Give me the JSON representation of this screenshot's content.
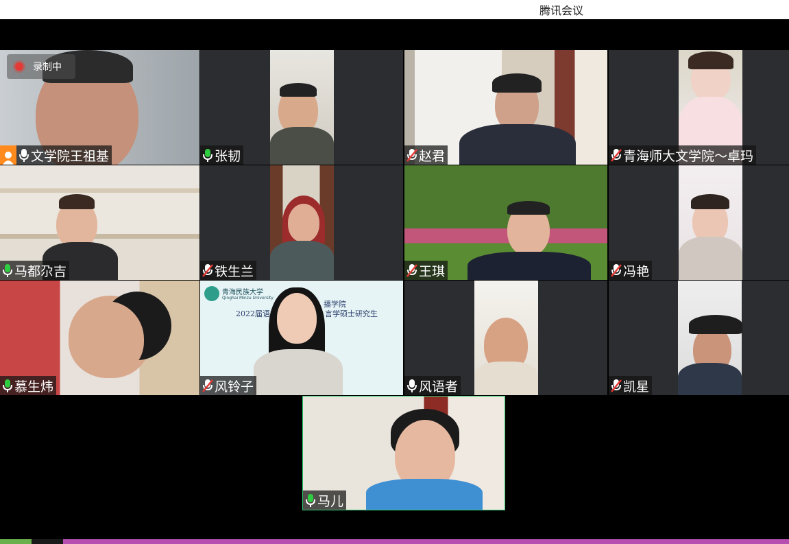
{
  "window": {
    "title": "腾讯会议"
  },
  "recording": {
    "label": "录制中"
  },
  "participants": [
    {
      "name": "文学院王祖基",
      "mic": "on",
      "host": true
    },
    {
      "name": "张韧",
      "mic": "on"
    },
    {
      "name": "赵君",
      "mic": "muted"
    },
    {
      "name": "青海师大文学院～卓玛",
      "mic": "muted"
    },
    {
      "name": "马都尕吉",
      "mic": "on"
    },
    {
      "name": "铁生兰",
      "mic": "muted"
    },
    {
      "name": "王琪",
      "mic": "muted"
    },
    {
      "name": "冯艳",
      "mic": "muted"
    },
    {
      "name": "慕生炜",
      "mic": "on"
    },
    {
      "name": "风铃子",
      "mic": "muted"
    },
    {
      "name": "风语者",
      "mic": "on"
    },
    {
      "name": "凯星",
      "mic": "muted"
    },
    {
      "name": "马儿",
      "mic": "on",
      "active_speaker": true
    }
  ],
  "slide": {
    "university": "青海民族大学",
    "university_en": "Qinghai Minzu University",
    "line1": "播学院",
    "line2": "2022届语言",
    "line3": "言学硕士研究生"
  },
  "colors": {
    "mic_on": "#2ecc40",
    "mic_muted": "#e53935",
    "host_badge": "#ff8a1e",
    "active_border": "#2ecc71"
  }
}
